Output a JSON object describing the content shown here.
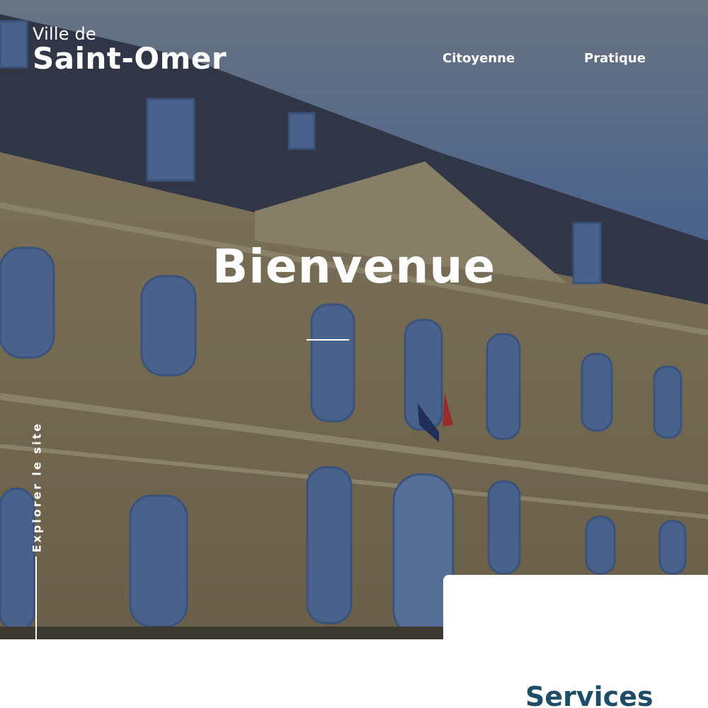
{
  "brand": {
    "prefix": "Ville de",
    "name": "Saint-Omer"
  },
  "nav": {
    "items": [
      "Citoyenne",
      "Pratique"
    ]
  },
  "hero": {
    "title": "Bienvenue",
    "explore_label": "Explorer le site",
    "image_icon": "town-hall-photo"
  },
  "services": {
    "title": "Services"
  },
  "colors": {
    "accent": "#1e4d68",
    "overlay": "#141820"
  }
}
